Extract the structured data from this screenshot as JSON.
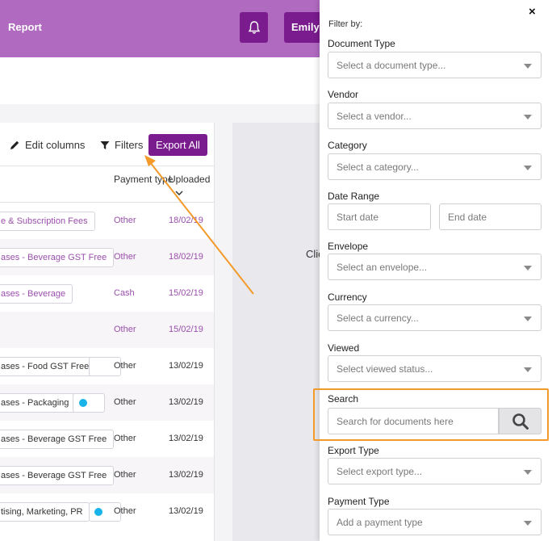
{
  "header": {
    "report_label": "Report",
    "user_label": "Emily T"
  },
  "toolbar": {
    "edit_columns": "Edit columns",
    "filters": "Filters",
    "export_all": "Export All"
  },
  "table": {
    "headers": {
      "payment_type": "Payment type",
      "uploaded": "Uploaded"
    },
    "rows": [
      {
        "category": "e & Subscription Fees",
        "payment": "Other",
        "date": "18/02/19",
        "muted": true
      },
      {
        "category": "ases - Beverage GST Free",
        "payment": "Other",
        "date": "18/02/19",
        "muted": true
      },
      {
        "category": "ases - Beverage",
        "payment": "Cash",
        "date": "15/02/19",
        "muted": true
      },
      {
        "category": "",
        "payment": "Other",
        "date": "15/02/19",
        "muted": true
      },
      {
        "category": "ases - Food GST Free",
        "payment": "Other",
        "date": "13/02/19",
        "muted": false
      },
      {
        "category": "ases - Packaging",
        "payment": "Other",
        "date": "13/02/19",
        "muted": false
      },
      {
        "category": "ases - Beverage GST Free",
        "payment": "Other",
        "date": "13/02/19",
        "muted": false
      },
      {
        "category": "ases - Beverage GST Free",
        "payment": "Other",
        "date": "13/02/19",
        "muted": false
      },
      {
        "category": "tising, Marketing, PR",
        "payment": "Other",
        "date": "13/02/19",
        "muted": false
      }
    ]
  },
  "preview": {
    "click_text": "Clic"
  },
  "filter_panel": {
    "title": "Filter by:",
    "close": "×",
    "document_type": {
      "label": "Document Type",
      "placeholder": "Select a document type..."
    },
    "vendor": {
      "label": "Vendor",
      "placeholder": "Select a vendor..."
    },
    "category": {
      "label": "Category",
      "placeholder": "Select a category..."
    },
    "date_range": {
      "label": "Date Range",
      "start_placeholder": "Start date",
      "end_placeholder": "End date"
    },
    "envelope": {
      "label": "Envelope",
      "placeholder": "Select an envelope..."
    },
    "currency": {
      "label": "Currency",
      "placeholder": "Select a currency..."
    },
    "viewed": {
      "label": "Viewed",
      "placeholder": "Select viewed status..."
    },
    "search": {
      "label": "Search",
      "placeholder": "Search for documents here"
    },
    "export_type": {
      "label": "Export Type",
      "placeholder": "Select export type..."
    },
    "payment_type": {
      "label": "Payment Type",
      "placeholder": "Add a payment type"
    }
  },
  "colors": {
    "brand_purple": "#7a1b8e",
    "header_bg": "#b06ac0",
    "highlight_orange": "#f39a2b"
  }
}
